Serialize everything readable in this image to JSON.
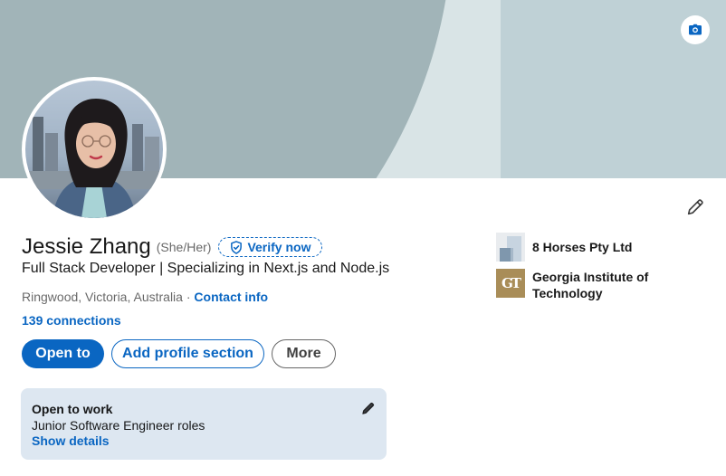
{
  "profile": {
    "name": "Jessie Zhang",
    "pronouns": "(She/Her)",
    "verify_label": "Verify now",
    "headline": "Full Stack Developer | Specializing in Next.js and Node.js",
    "location": "Ringwood, Victoria, Australia",
    "separator": " · ",
    "contact_label": "Contact info",
    "connections": "139 connections"
  },
  "actions": {
    "open_to_label": "Open to",
    "add_section_label": "Add profile section",
    "more_label": "More"
  },
  "open_to_work": {
    "title": "Open to work",
    "roles": "Junior Software Engineer roles",
    "details_label": "Show details"
  },
  "experience": {
    "company": "8 Horses Pty Ltd",
    "school": "Georgia Institute of Technology",
    "school_logo_text": "GT"
  },
  "icons": {
    "banner_edit": "camera-icon",
    "intro_edit": "pencil-icon",
    "verify": "shield-check-icon",
    "card_edit": "pencil-icon"
  },
  "colors": {
    "accent": "#0a66c2",
    "banner_dark": "#a1b4b8",
    "banner_light": "#d9e4e6",
    "banner_right": "#bfd1d6",
    "card_bg": "#dde7f1"
  }
}
